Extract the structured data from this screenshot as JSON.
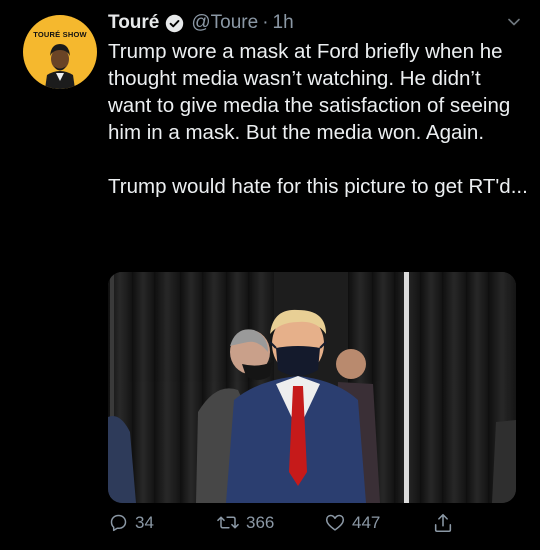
{
  "avatar": {
    "label": "TOURÉ SHOW"
  },
  "tweet": {
    "display_name": "Touré",
    "handle": "@Toure",
    "time": "1h",
    "text_p1": "Trump wore a mask at Ford briefly when he thought media wasn’t watching. He didn’t want to give media the satisfaction of seeing him in a mask. But the media won. Again.",
    "text_p2": "Trump would hate for this picture to get RT'd..."
  },
  "actions": {
    "replies": "34",
    "retweets": "366",
    "likes": "447"
  },
  "colors": {
    "background": "#000000",
    "text": "#e7e9ea",
    "secondary": "#8b98a5",
    "avatar_bg": "#f5b82e"
  },
  "icons": [
    "verified-badge-icon",
    "chevron-down-icon",
    "reply-icon",
    "retweet-icon",
    "like-icon",
    "share-icon"
  ]
}
